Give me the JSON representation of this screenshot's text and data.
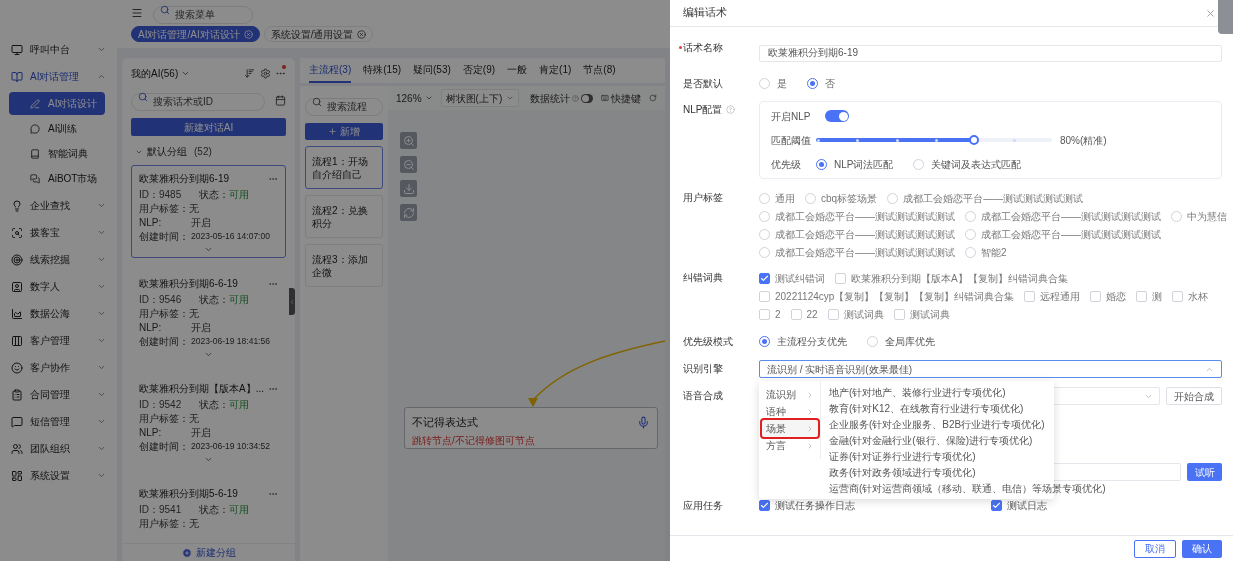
{
  "sidebar": {
    "items": [
      {
        "label": "呼叫中台",
        "expanded": false
      },
      {
        "label": "AI对话管理",
        "expanded": true,
        "children": [
          {
            "label": "AI对话设计",
            "selected": true
          },
          {
            "label": "AI训练",
            "selected": false
          },
          {
            "label": "智能词典",
            "selected": false
          },
          {
            "label": "AiBOT市场",
            "selected": false
          }
        ]
      },
      {
        "label": "企业查找",
        "expanded": false
      },
      {
        "label": "拨客宝",
        "expanded": false
      },
      {
        "label": "线索挖掘",
        "expanded": false
      },
      {
        "label": "数字人",
        "expanded": false
      },
      {
        "label": "数据公海",
        "expanded": false
      },
      {
        "label": "客户管理",
        "expanded": false
      },
      {
        "label": "客户协作",
        "expanded": false
      },
      {
        "label": "合同管理",
        "expanded": false
      },
      {
        "label": "短信管理",
        "expanded": false
      },
      {
        "label": "团队组织",
        "expanded": false
      },
      {
        "label": "系统设置",
        "expanded": false
      }
    ]
  },
  "topbar": {
    "search_placeholder": "搜索菜单"
  },
  "page_tabs": [
    {
      "label": "AI对话管理/AI对话设计",
      "selected": true
    },
    {
      "label": "系统设置/通用设置",
      "selected": false
    }
  ],
  "ai_list": {
    "title": "我的AI(56)",
    "search_placeholder": "搜索话术或ID",
    "new_button": "新建对话AI",
    "group": {
      "name": "默认分组",
      "count": "(52)",
      "expanded": true
    },
    "cards": [
      {
        "title": "欧莱雅积分到期6-19",
        "id_label": "ID：",
        "id": "9485",
        "status_label": "状态：",
        "status": "可用",
        "tag_label": "用户标签：",
        "tag": "无",
        "nlp_label": "NLP:",
        "nlp": "开启",
        "time_label": "创建时间：",
        "time": "2023-05-16 14:07:00",
        "selected": true
      },
      {
        "title": "欧莱雅积分到期6-6-19",
        "id_label": "ID：",
        "id": "9546",
        "status_label": "状态：",
        "status": "可用",
        "tag_label": "用户标签：",
        "tag": "无",
        "nlp_label": "NLP:",
        "nlp": "开启",
        "time_label": "创建时间：",
        "time": "2023-06-19 18:41:56",
        "selected": false
      },
      {
        "title": "欧莱雅积分到期【版本A】...",
        "id_label": "ID：",
        "id": "9542",
        "status_label": "状态：",
        "status": "可用",
        "tag_label": "用户标签：",
        "tag": "无",
        "nlp_label": "NLP:",
        "nlp": "开启",
        "time_label": "创建时间：",
        "time": "2023-06-19 10:34:52",
        "selected": false
      },
      {
        "title": "欧莱雅积分到期5-6-19",
        "id_label": "ID：",
        "id": "9541",
        "status_label": "状态：",
        "status": "可用",
        "tag_label": "用户标签：",
        "tag": "无",
        "selected": false
      }
    ],
    "add_group": "新建分组"
  },
  "flow": {
    "tabs": [
      {
        "label": "主流程(3)",
        "selected": true
      },
      {
        "label": "特殊(15)",
        "selected": false
      },
      {
        "label": "疑问(53)",
        "selected": false
      },
      {
        "label": "否定(9)",
        "selected": false
      },
      {
        "label": "一般",
        "selected": false
      },
      {
        "label": "肯定(1)",
        "selected": false
      },
      {
        "label": "节点(8)",
        "selected": false
      }
    ],
    "search_placeholder": "搜索流程",
    "add_button": "新增",
    "flows": [
      {
        "label": "流程1：开场自介绍自己",
        "selected": true
      },
      {
        "label": "流程2：兑换积分",
        "selected": false
      },
      {
        "label": "流程3：添加企微",
        "selected": false
      }
    ],
    "toolbar": {
      "zoom": "126%",
      "layout": "树状图(上下)",
      "stats_label": "数据统计",
      "stats_on": false,
      "shortcut": "快捷键"
    },
    "node": {
      "title": "不记得表达式",
      "subtitle": "跳转节点/不记得修图可节点"
    }
  },
  "drawer": {
    "title": "编辑话术",
    "name": {
      "label": "话术名称",
      "required": true,
      "value": "欧莱雅积分到期6-19"
    },
    "default": {
      "label": "是否默认",
      "options": [
        {
          "label": "是",
          "selected": false
        },
        {
          "label": "否",
          "selected": true
        }
      ]
    },
    "nlp": {
      "label": "NLP配置",
      "enable_label": "开启NLP",
      "enabled": true,
      "threshold_label": "匹配阈值",
      "level": 0.67,
      "reading": "80%(精准)",
      "priority_label": "优先级",
      "priority_options": [
        {
          "label": "NLP词法匹配",
          "selected": true
        },
        {
          "label": "关键词及表达式匹配",
          "selected": false
        }
      ]
    },
    "user_tags": {
      "label": "用户标签",
      "options": [
        {
          "label": "通用",
          "selected": false
        },
        {
          "label": "cbq标签场景",
          "selected": false
        },
        {
          "label": "成都工会婚恋平台——测试测试测试测试",
          "selected": false
        },
        {
          "label": "成都工会婚恋平台——测试测试测试测试",
          "selected": false
        },
        {
          "label": "成都工会婚恋平台——测试测试测试测试",
          "selected": false
        },
        {
          "label": "中为慧信",
          "selected": false
        },
        {
          "label": "成都工会婚恋平台——测试测试测试测试",
          "selected": false
        },
        {
          "label": "成都工会婚恋平台——测试测试测试测试",
          "selected": false
        },
        {
          "label": "成都工会婚恋平台——测试测试测试测试",
          "selected": false
        },
        {
          "label": "智能2",
          "selected": false
        }
      ]
    },
    "dictionary": {
      "label": "纠错词典",
      "options": [
        {
          "label": "测试纠错词",
          "checked": true
        },
        {
          "label": "欧莱雅积分到期【版本A】【复制】纠错词典合集",
          "checked": false
        },
        {
          "label": "20221124cyp【复制】【复制】【复制】纠错词典合集",
          "checked": false
        },
        {
          "label": "远程通用",
          "checked": false
        },
        {
          "label": "婚恋",
          "checked": false
        },
        {
          "label": "测",
          "checked": false
        },
        {
          "label": "水杯",
          "checked": false
        },
        {
          "label": "2",
          "checked": false
        },
        {
          "label": "22",
          "checked": false
        },
        {
          "label": "测试词典",
          "checked": false
        },
        {
          "label": "测试词典",
          "checked": false
        }
      ]
    },
    "priority_mode": {
      "label": "优先级模式",
      "options": [
        {
          "label": "主流程分支优先",
          "selected": true
        },
        {
          "label": "全局库优先",
          "selected": false
        }
      ]
    },
    "engine": {
      "label": "识别引擎",
      "value": "流识别 / 实时语音识别(效果最佳)",
      "expanded": true,
      "categories": [
        {
          "label": "流识别",
          "selected": false
        },
        {
          "label": "语种",
          "selected": false
        },
        {
          "label": "场景",
          "selected": true
        },
        {
          "label": "方言",
          "selected": false
        }
      ],
      "options": [
        "地产(针对地产、装修行业进行专项优化)",
        "教育(针对K12、在线教育行业进行专项优化)",
        "企业服务(针对企业服务、B2B行业进行专项优化)",
        "金融(针对金融行业(银行、保险)进行专项优化)",
        "证券(针对证券行业进行专项优化)",
        "政务(针对政务领域进行专项优化)",
        "运营商(针对运营商领域（移动、联通、电信）等场景专项优化)"
      ]
    },
    "tts": {
      "label": "语音合成",
      "button": "开始合成",
      "listen_button": "试听"
    },
    "tasks": {
      "label": "应用任务",
      "items": [
        {
          "label": "测试任务操作日志",
          "checked": true
        },
        {
          "label": "测试日志",
          "checked": true
        }
      ]
    },
    "footer": {
      "cancel": "取消",
      "confirm": "确认"
    }
  }
}
